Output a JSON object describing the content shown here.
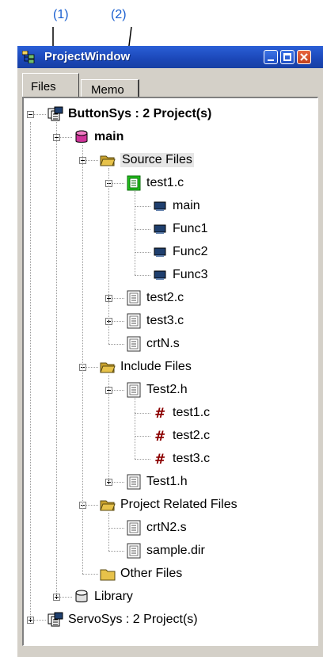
{
  "callouts": [
    {
      "label": "(1)"
    },
    {
      "label": "(2)"
    }
  ],
  "window": {
    "title": "ProjectWindow",
    "tabs": [
      "Files",
      "Memo"
    ]
  },
  "tree": [
    {
      "label": "ButtonSys : 2 Project(s)",
      "icon": "project-group-icon",
      "bold": true,
      "expander": "minus"
    },
    {
      "label": "main",
      "icon": "project-cylinder-icon",
      "bold": true,
      "expander": "minus"
    },
    {
      "label": "Source Files",
      "icon": "folder-open-icon",
      "expander": "minus",
      "selected": true
    },
    {
      "label": "test1.c",
      "icon": "source-file-active-icon",
      "expander": "minus"
    },
    {
      "label": "main",
      "icon": "function-icon"
    },
    {
      "label": "Func1",
      "icon": "function-icon"
    },
    {
      "label": "Func2",
      "icon": "function-icon"
    },
    {
      "label": "Func3",
      "icon": "function-icon"
    },
    {
      "label": "test2.c",
      "icon": "source-file-icon",
      "expander": "plus"
    },
    {
      "label": "test3.c",
      "icon": "source-file-icon",
      "expander": "plus"
    },
    {
      "label": "crtN.s",
      "icon": "source-file-icon"
    },
    {
      "label": "Include Files",
      "icon": "folder-open-icon",
      "expander": "minus"
    },
    {
      "label": "Test2.h",
      "icon": "source-file-icon",
      "expander": "minus"
    },
    {
      "label": "test1.c",
      "icon": "include-hash-icon"
    },
    {
      "label": "test2.c",
      "icon": "include-hash-icon"
    },
    {
      "label": "test3.c",
      "icon": "include-hash-icon"
    },
    {
      "label": "Test1.h",
      "icon": "source-file-icon",
      "expander": "plus"
    },
    {
      "label": "Project Related Files",
      "icon": "folder-open-icon",
      "expander": "minus"
    },
    {
      "label": "crtN2.s",
      "icon": "source-file-icon"
    },
    {
      "label": "sample.dir",
      "icon": "source-file-icon"
    },
    {
      "label": "Other Files",
      "icon": "folder-closed-icon"
    },
    {
      "label": "Library",
      "icon": "library-cylinder-icon",
      "expander": "plus"
    },
    {
      "label": "ServoSys : 2 Project(s)",
      "icon": "project-group-icon",
      "expander": "plus"
    }
  ],
  "colors": {
    "callout": "#1a5fd0",
    "titlebar": "#1b47b8",
    "window_face": "#d4d0c8",
    "function_icon": "#1f3f6e",
    "hash_icon": "#8b0000",
    "folder": "#e7c24a",
    "project_cylinder": "#d0339a",
    "active_file": "#22c21c"
  }
}
